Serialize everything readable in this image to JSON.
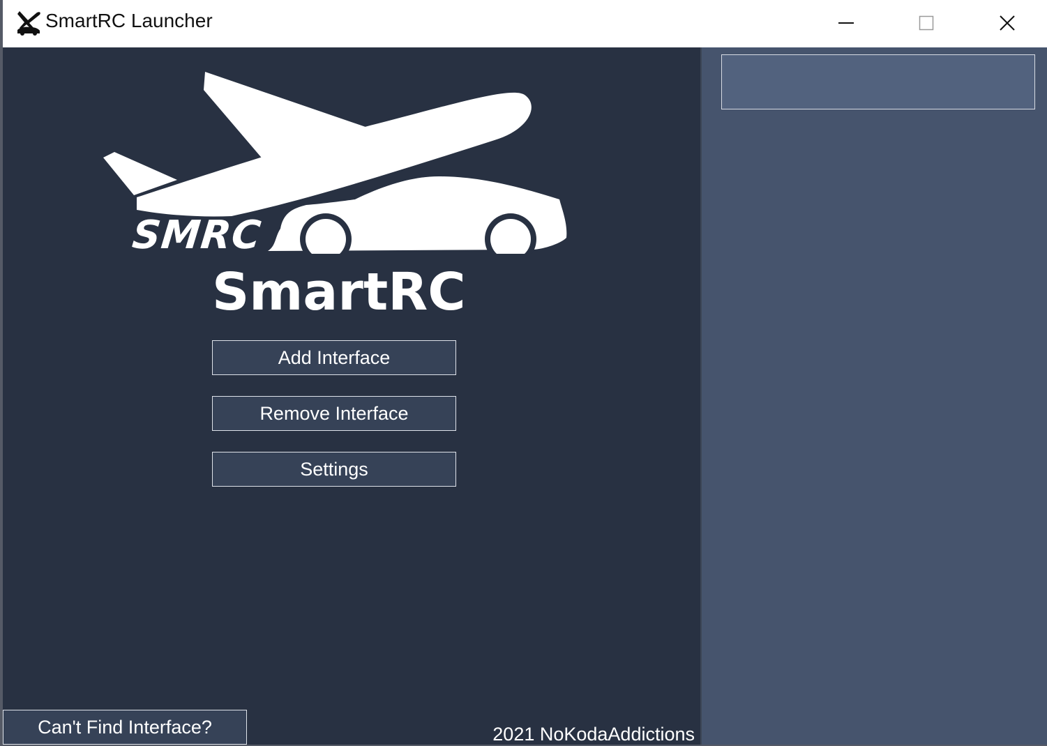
{
  "window": {
    "title": "SmartRC Launcher",
    "icon": "smartrc-app-icon",
    "controls": {
      "minimize_icon": "minimize-icon",
      "maximize_icon": "maximize-icon",
      "close_icon": "close-icon"
    }
  },
  "logo": {
    "badge_text": "SMRC",
    "app_name": "SmartRC",
    "graphic": "airplane-and-car-logo"
  },
  "menu": {
    "add_interface": "Add Interface",
    "remove_interface": "Remove Interface",
    "settings": "Settings"
  },
  "footer": {
    "cant_find": "Can't Find Interface?",
    "copyright": "2021 NoKodaAddictions"
  },
  "interface_list": {
    "items": []
  },
  "colors": {
    "left_pane": "#283142",
    "right_pane": "#46546d",
    "button_bg": "#364257",
    "interface_box": "#52627e",
    "accent_text": "#ffffff"
  }
}
